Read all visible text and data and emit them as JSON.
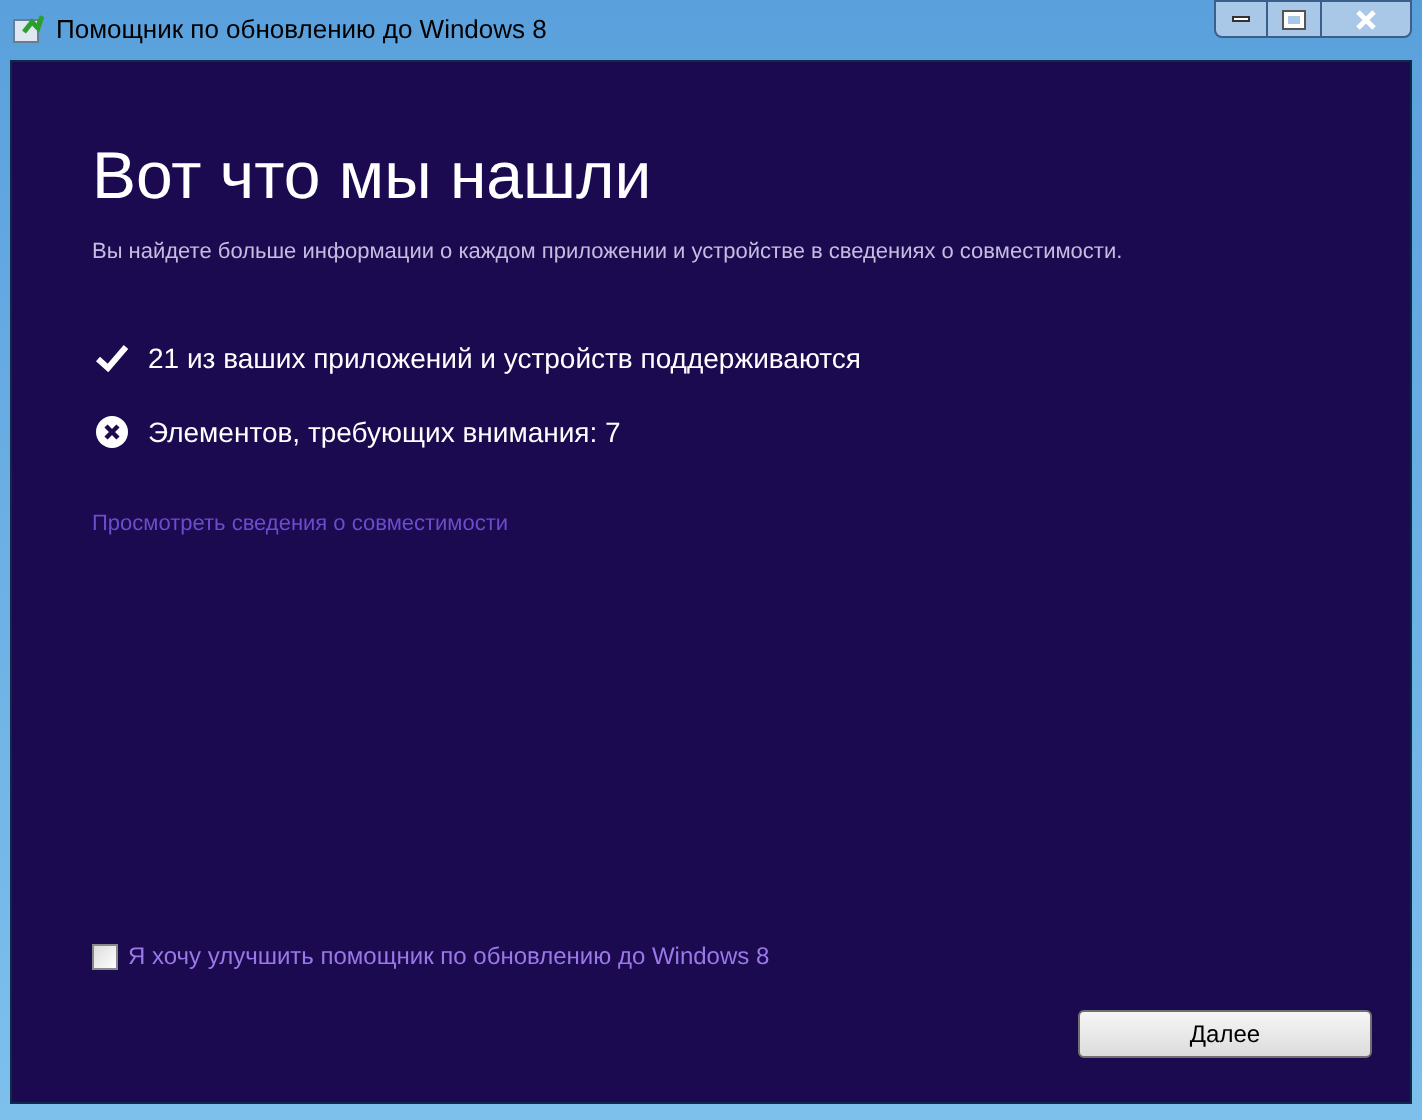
{
  "window": {
    "title": "Помощник по обновлению до Windows 8"
  },
  "heading": "Вот что мы нашли",
  "subtitle": "Вы найдете больше информации о каждом приложении и устройстве в сведениях о совместимости.",
  "results": [
    {
      "kind": "ok",
      "text": "21 из ваших приложений и устройств поддерживаются"
    },
    {
      "kind": "error",
      "text": "Элементов, требующих внимания: 7"
    }
  ],
  "details_link": "Просмотреть сведения о совместимости",
  "improve_checkbox": {
    "label": "Я хочу улучшить помощник по обновлению до Windows 8",
    "checked": false
  },
  "buttons": [
    "Далее"
  ]
}
